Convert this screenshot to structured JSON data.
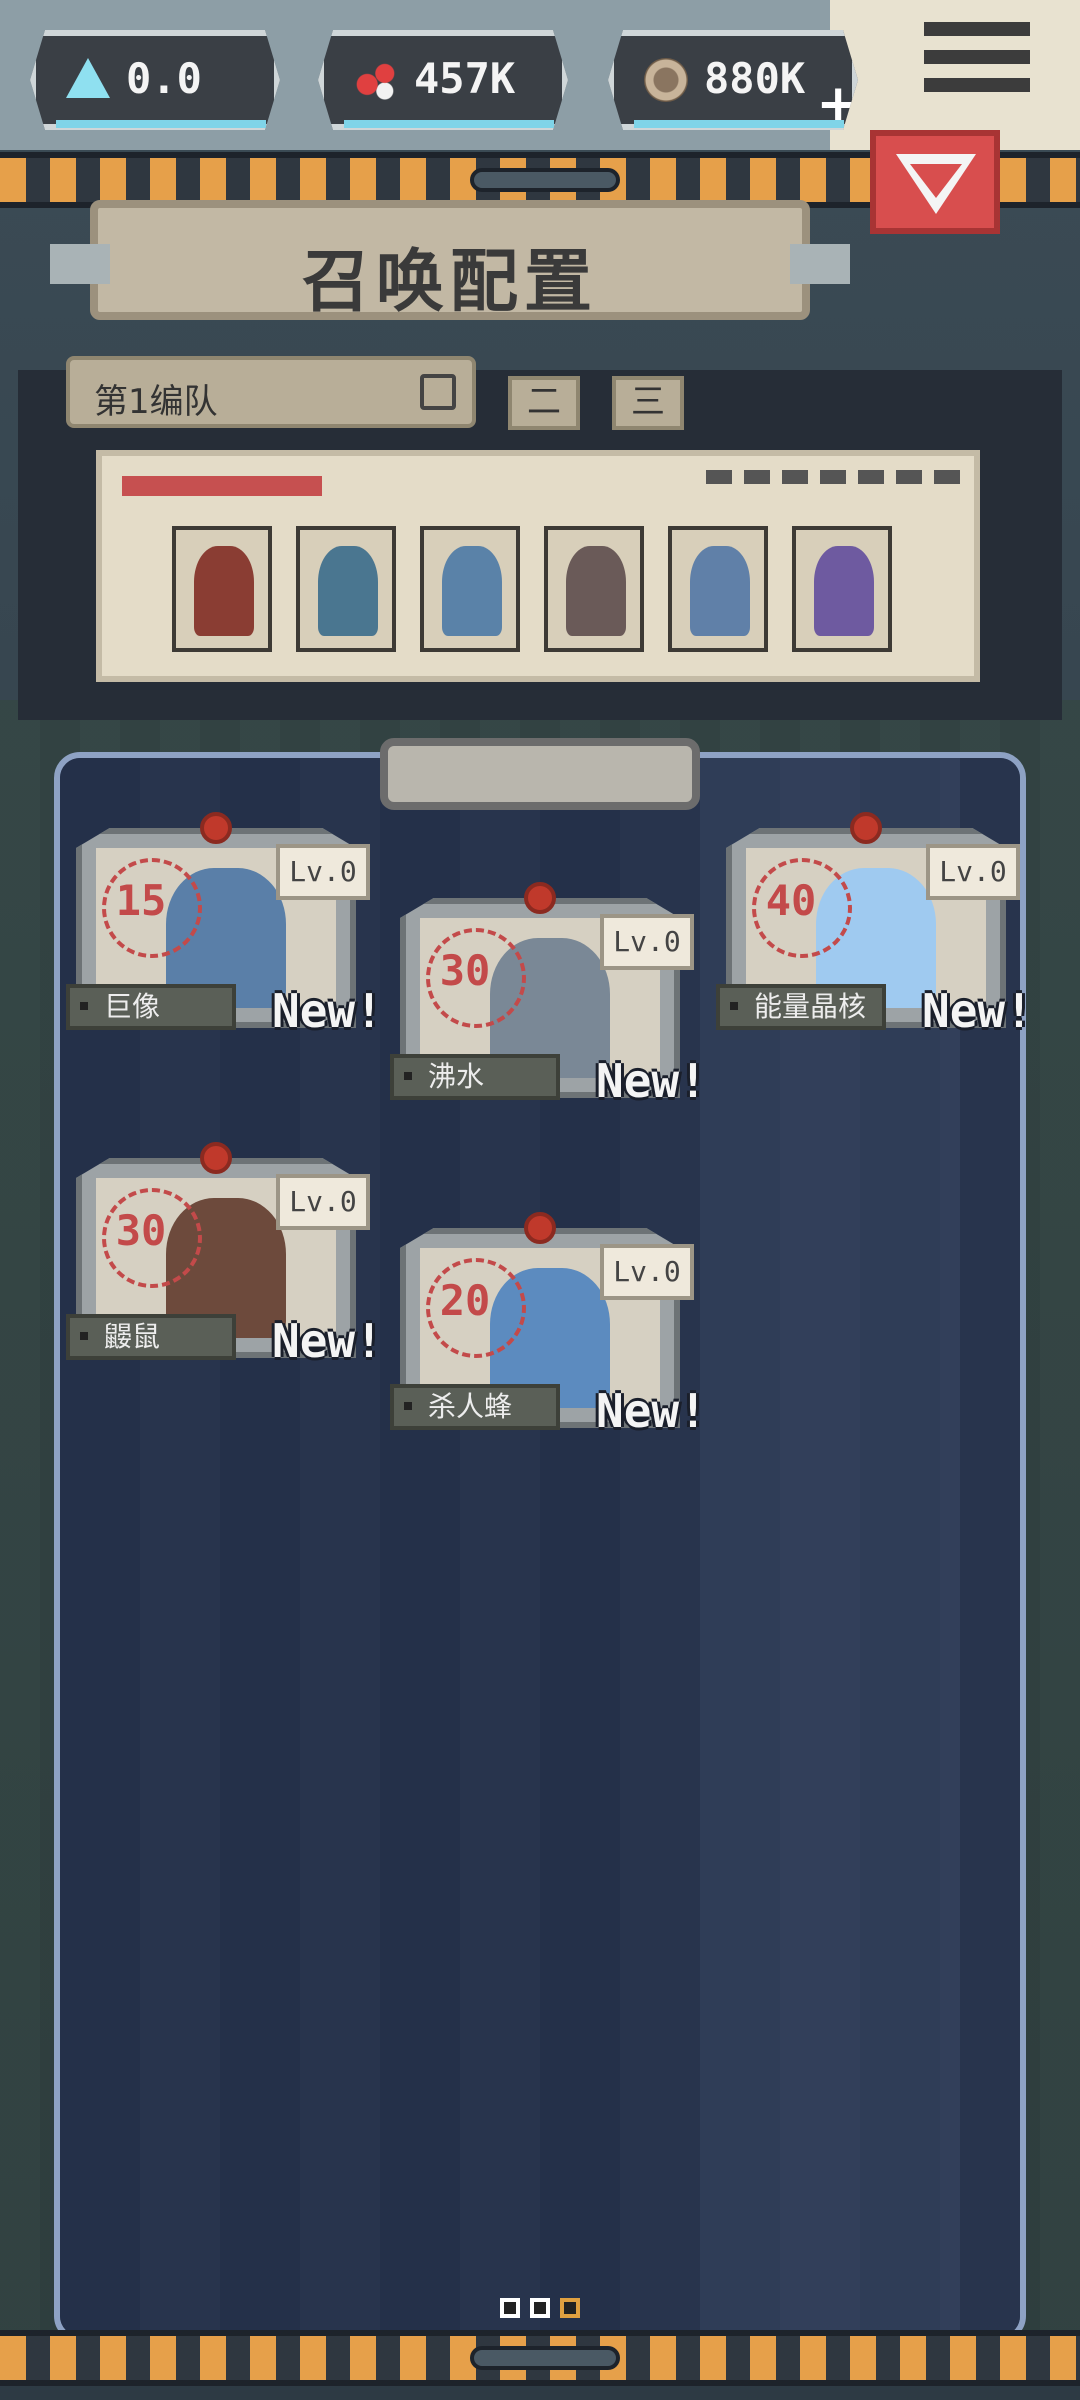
{
  "currencies": [
    {
      "icon": "triangle-crystal-icon",
      "value": "0.0"
    },
    {
      "icon": "red-gem-icon",
      "value": "457K"
    },
    {
      "icon": "coin-icon",
      "value": "880K",
      "add": "+"
    }
  ],
  "header": {
    "title": "召唤配置"
  },
  "team": {
    "selected": "第1编队",
    "tabs": [
      "二",
      "三"
    ]
  },
  "roster_slots": 6,
  "cards": [
    {
      "name": "巨像",
      "cost": "15",
      "level": "Lv.0",
      "badge": "New!",
      "color": "#5a7fa8"
    },
    {
      "name": "沸水",
      "cost": "30",
      "level": "Lv.0",
      "badge": "New!",
      "color": "#7a8896"
    },
    {
      "name": "能量晶核",
      "cost": "40",
      "level": "Lv.0",
      "badge": "New!",
      "color": "#9fcaf0"
    },
    {
      "name": "鼹鼠",
      "cost": "30",
      "level": "Lv.0",
      "badge": "New!",
      "color": "#6d4a3c"
    },
    {
      "name": "杀人蜂",
      "cost": "20",
      "level": "Lv.0",
      "badge": "New!",
      "color": "#5c8bbf"
    }
  ],
  "colors": {
    "accent_red": "#d84e4e",
    "stripe_orange": "#e6a04a",
    "board_bg": "#26324a",
    "cyan": "#7fd4e8"
  }
}
